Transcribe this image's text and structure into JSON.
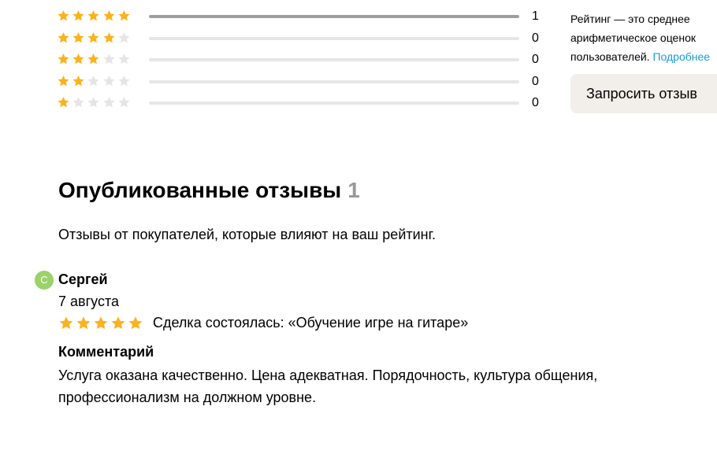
{
  "breakdown": [
    {
      "stars": 5,
      "count": "1",
      "share": 1.0
    },
    {
      "stars": 4,
      "count": "0",
      "share": 0
    },
    {
      "stars": 3,
      "count": "0",
      "share": 0
    },
    {
      "stars": 2,
      "count": "0",
      "share": 0
    },
    {
      "stars": 1,
      "count": "0",
      "share": 0
    }
  ],
  "aside": {
    "line1": "Рейтинг — это среднее",
    "line2": "арифметическое оценок",
    "line3": "пользователей.",
    "link": "Подробнее"
  },
  "request_button": "Запросить отзыв",
  "section": {
    "title": "Опубликованные отзывы",
    "count": "1",
    "description": "Отзывы от покупателей, которые влияют на ваш рейтинг."
  },
  "review": {
    "avatar_letter": "С",
    "author": "Сергей",
    "date": "7 августа",
    "rating": 5,
    "deal": "Сделка состоялась: «Обучение игре на гитаре»",
    "comment_label": "Комментарий",
    "comment": "Услуга оказана качественно. Цена адекватная. Порядочность, культура общения, профессионализм на должном уровне."
  },
  "colors": {
    "star_filled": "#fcb21c",
    "star_empty": "#e5e5e5",
    "bar_fill": "#9e9e9e",
    "link": "#1a9ad9",
    "avatar": "#9bd26a"
  }
}
